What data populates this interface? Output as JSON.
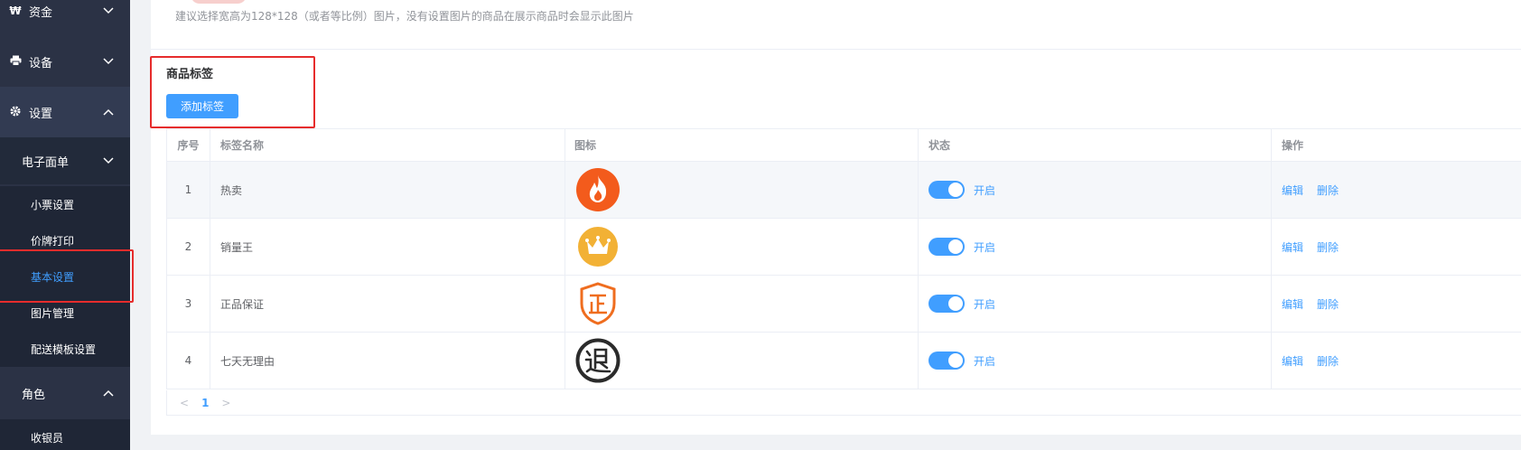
{
  "sidebar": {
    "funds": {
      "label": "资金",
      "icon": "won-icon"
    },
    "device": {
      "label": "设备",
      "icon": "printer-icon"
    },
    "settings": {
      "label": "设置",
      "icon": "gear-icon"
    },
    "e_waybill": {
      "label": "电子面单"
    },
    "leaves": [
      {
        "label": "小票设置"
      },
      {
        "label": "价牌打印"
      },
      {
        "label": "基本设置",
        "active": true
      },
      {
        "label": "图片管理"
      },
      {
        "label": "配送模板设置"
      }
    ],
    "role": {
      "label": "角色"
    },
    "cut_item": {
      "label": "收银员"
    }
  },
  "main": {
    "image_hint": "建议选择宽高为128*128（或者等比例）图片，没有设置图片的商品在展示商品时会显示此图片",
    "tags_title": "商品标签",
    "add_button": "添加标签",
    "table": {
      "headers": {
        "index": "序号",
        "name": "标签名称",
        "icon": "图标",
        "status": "状态",
        "action": "操作"
      },
      "rows": [
        {
          "index": "1",
          "name": "热卖",
          "icon": "fire-icon",
          "status": "开启",
          "edit": "编辑",
          "delete": "删除"
        },
        {
          "index": "2",
          "name": "销量王",
          "icon": "crown-icon",
          "status": "开启",
          "edit": "编辑",
          "delete": "删除"
        },
        {
          "index": "3",
          "name": "正品保证",
          "icon": "shield-zheng-icon",
          "status": "开启",
          "edit": "编辑",
          "delete": "删除"
        },
        {
          "index": "4",
          "name": "七天无理由",
          "icon": "tui-return-icon",
          "status": "开启",
          "edit": "编辑",
          "delete": "删除"
        }
      ]
    },
    "pager": {
      "current": "1"
    }
  },
  "colors": {
    "accent": "#409eff",
    "sidebar_bg": "#2b3245",
    "highlight": "#e62c2c",
    "fire": "#f35b1c",
    "crown_bg": "#f2b135",
    "shield": "#ef6d1f"
  }
}
